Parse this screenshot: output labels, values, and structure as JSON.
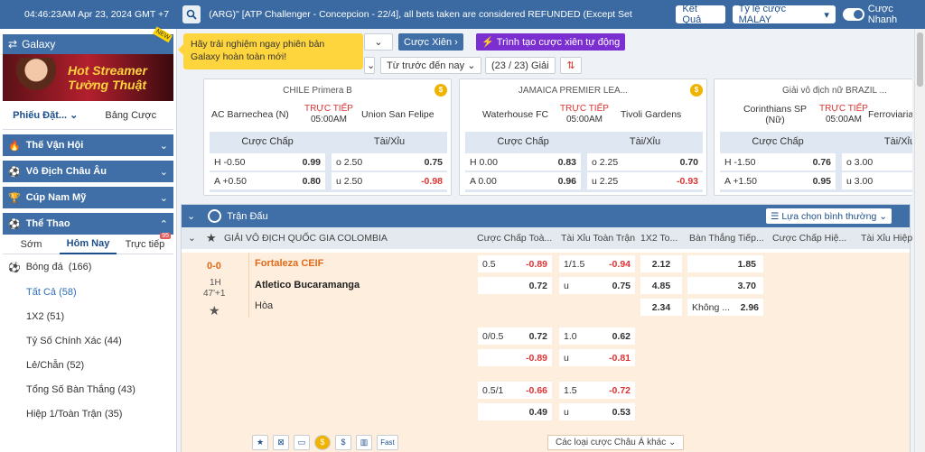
{
  "topbar": {
    "time": "04:46:23AM Apr 23, 2024 GMT +7",
    "marquee": "(ARG)\" [ATP Challenger - Concepcion - 22/4], all bets taken are considered REFUNDED (Except Set",
    "ket_qua": "Kết Quả",
    "odds_type": "Tỷ lệ cược MALAY",
    "fast_bet": "Cược Nhanh"
  },
  "sidebar": {
    "galaxy": "Galaxy",
    "new_tag": "NEW",
    "banner_line1": "Hot Streamer",
    "banner_line2": "Tường Thuật",
    "tab_slip": "Phiếu Đặt...",
    "tab_table": "Bảng Cược",
    "categories": [
      "Thế Vận Hội",
      "Vô Địch Châu Âu",
      "Cúp Nam Mỹ",
      "Thể Thao"
    ],
    "subtabs": {
      "early": "Sớm",
      "today": "Hôm Nay",
      "live": "Trực tiếp",
      "live_count": "95"
    },
    "sport": "Bóng đá",
    "sport_count": "(166)",
    "items": [
      {
        "label": "Tất Cả",
        "count": "(58)"
      },
      {
        "label": "1X2",
        "count": "(51)"
      },
      {
        "label": "Tỷ Số Chính Xác",
        "count": "(44)"
      },
      {
        "label": "Lẻ/Chẵn",
        "count": "(52)"
      },
      {
        "label": "Tổng Số Bàn Thắng",
        "count": "(43)"
      },
      {
        "label": "Hiệp 1/Toàn Trận",
        "count": "(35)"
      }
    ]
  },
  "tooltip": "Hãy trải nghiệm ngay phiên bản Galaxy hoàn toàn mới!",
  "filters": {
    "parlay": "Cược Xiên",
    "create_parlay": "Trình tạo cược xiên tự động",
    "sort": "Từ trước đến nay",
    "count": "(23 / 23) Giải"
  },
  "cards": [
    {
      "league": "CHILE Primera B",
      "home": "AC Barnechea (N)",
      "away": "Union San Felipe",
      "live": "TRỰC TIẾP",
      "time": "05:00AM",
      "hdp_label": "Cược Chấp",
      "ou_label": "Tài/Xỉu",
      "rows": [
        [
          "H -0.50",
          "0.99",
          "o 2.50",
          "0.75"
        ],
        [
          "A +0.50",
          "0.80",
          "u 2.50",
          "-0.98"
        ]
      ]
    },
    {
      "league": "JAMAICA PREMIER LEA...",
      "home": "Waterhouse FC",
      "away": "Tivoli Gardens",
      "live": "TRỰC TIẾP",
      "time": "05:00AM",
      "hdp_label": "Cược Chấp",
      "ou_label": "Tài/Xỉu",
      "rows": [
        [
          "H 0.00",
          "0.83",
          "o 2.25",
          "0.70"
        ],
        [
          "A 0.00",
          "0.96",
          "u 2.25",
          "-0.93"
        ]
      ]
    },
    {
      "league": "Giải vô địch nữ BRAZIL ...",
      "home": "Corinthians SP (Nữ)",
      "away": "Ferroviaria",
      "live": "TRỰC TIẾP",
      "time": "05:00AM",
      "hdp_label": "Cược Chấp",
      "ou_label": "Tài/Xỉu",
      "rows": [
        [
          "H -1.50",
          "0.76",
          "o 3.00",
          ""
        ],
        [
          "A +1.50",
          "0.95",
          "u 3.00",
          ""
        ]
      ]
    }
  ],
  "main": {
    "header": "Trận Đấu",
    "select": "Lựa chọn bình thường",
    "league": "GIẢI VÔ ĐỊCH QUỐC GIA COLOMBIA",
    "cols": [
      "Cược Chấp Toà...",
      "Tài Xỉu Toàn Trận",
      "1X2 To...",
      "Bàn Thắng Tiếp...",
      "Cược Chấp Hiệ...",
      "Tài Xỉu Hiệp"
    ],
    "score": "0-0",
    "period": "1H",
    "minute": "47'+1",
    "home": "Fortaleza CEIF",
    "away": "Atletico Bucaramanga",
    "draw": "Hòa",
    "odds": [
      {
        "hdp": "0.5",
        "hdp_h": "-0.89",
        "hdp_a": "0.72",
        "ou": "1/1.5",
        "ou_o": "-0.94",
        "ou_uL": "u",
        "ou_u": "0.75"
      },
      {
        "hdp": "0/0.5",
        "hdp_h": "0.72",
        "hdp_a": "-0.89",
        "ou": "1.0",
        "ou_o": "0.62",
        "ou_uL": "u",
        "ou_u": "-0.81"
      },
      {
        "hdp": "0.5/1",
        "hdp_h": "-0.66",
        "hdp_a": "0.49",
        "ou": "1.5",
        "ou_o": "-0.72",
        "ou_uL": "u",
        "ou_u": "0.53"
      }
    ],
    "x12": [
      "2.12",
      "4.85",
      "2.34"
    ],
    "next_goal": [
      "1.85",
      "3.70",
      "2.96"
    ],
    "next_goal_none": "Không ...",
    "more_markets": "Các loại cược Châu Á khác",
    "fast": "Fast"
  }
}
